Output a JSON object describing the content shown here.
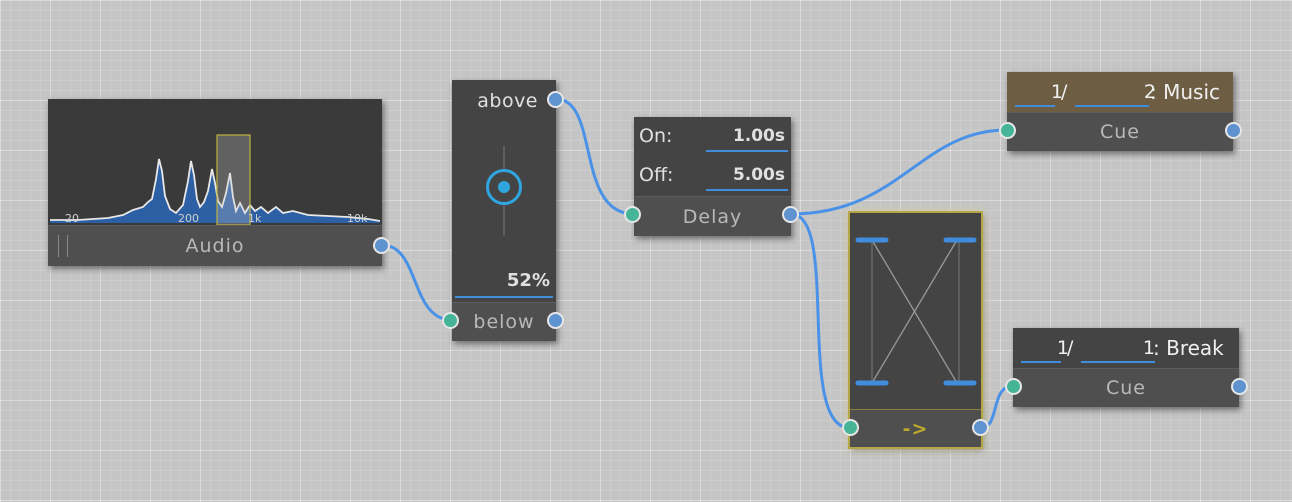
{
  "audio": {
    "title": "Audio",
    "freq_labels": [
      "20",
      "200",
      "1k",
      "10k"
    ]
  },
  "threshold": {
    "above_label": "above",
    "below_label": "below",
    "value": "52%"
  },
  "delay": {
    "title": "Delay",
    "on_label": "On:",
    "on_value": "1.00s",
    "off_label": "Off:",
    "off_value": "5.00s"
  },
  "toggle": {
    "arrow_label": "->"
  },
  "cue_music": {
    "title": "Cue",
    "index": "1",
    "separator": "/",
    "number": "2",
    "name": ": Music"
  },
  "cue_break": {
    "title": "Cue",
    "index": "1",
    "separator": "/",
    "number": "1",
    "name": ": Break"
  },
  "colors": {
    "wire": "#4a92e8",
    "port_out": "#5f93cf",
    "port_in": "#46b497",
    "node_bg": "#444444",
    "active_cue_header": "#6d5e43",
    "toggle_outline": "#b5a646",
    "spectrum_fill": "#2c5fa3"
  }
}
